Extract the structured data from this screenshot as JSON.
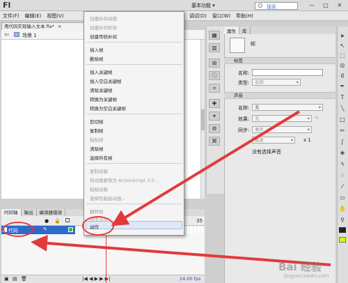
{
  "app": {
    "logo": "Fl",
    "workspace": "基本功能 ▾",
    "search_placeholder": "搜索"
  },
  "window_controls": {
    "minimize": "—",
    "maximize": "□",
    "close": "✕"
  },
  "menubar": {
    "items": [
      "文件(F)",
      "编辑(E)",
      "视图(V)"
    ],
    "right_items": [
      "调试(D)",
      "窗口(W)",
      "帮助(H)"
    ]
  },
  "document": {
    "tab_title": "用代码实现输入文本.fla*",
    "tab_close": "×",
    "scene": "场景 1"
  },
  "context_menu": {
    "items": [
      {
        "label": "创建补间动画",
        "enabled": false
      },
      {
        "label": "创建补间形状",
        "enabled": false
      },
      {
        "label": "创建传统补间",
        "enabled": true
      },
      {
        "label": "插入帧",
        "enabled": true
      },
      {
        "label": "删除帧",
        "enabled": true
      },
      {
        "label": "插入关键帧",
        "enabled": true
      },
      {
        "label": "插入空白关键帧",
        "enabled": true
      },
      {
        "label": "清除关键帧",
        "enabled": true
      },
      {
        "label": "转换为关键帧",
        "enabled": true
      },
      {
        "label": "转换为空白关键帧",
        "enabled": true
      },
      {
        "label": "剪切帧",
        "enabled": true
      },
      {
        "label": "复制帧",
        "enabled": true
      },
      {
        "label": "粘贴帧",
        "enabled": false
      },
      {
        "label": "清除帧",
        "enabled": true
      },
      {
        "label": "选择所有帧",
        "enabled": true
      },
      {
        "label": "复制动画",
        "enabled": false
      },
      {
        "label": "将动画复制为 ActionScript 3.0...",
        "enabled": false
      },
      {
        "label": "粘贴动画",
        "enabled": false
      },
      {
        "label": "选择性粘贴动画...",
        "enabled": false
      },
      {
        "label": "翻转帧",
        "enabled": false
      },
      {
        "label": "同步元件",
        "enabled": false
      },
      {
        "label": "动作",
        "enabled": true
      }
    ]
  },
  "timeline": {
    "tabs": [
      "时间轴",
      "输出",
      "编译器错误"
    ],
    "frame_number": "35",
    "layer_name": "代码",
    "fps": "24.00 fps",
    "time": "0.0 s"
  },
  "properties": {
    "tabs": [
      "属性",
      "库"
    ],
    "object_type": "帧",
    "label_section": "标签",
    "name_label": "名称:",
    "type_label": "类型:",
    "type_value": "名称",
    "sound_section": "声音",
    "sound_name_label": "名称:",
    "sound_name_value": "无",
    "effect_label": "效果:",
    "effect_value": "无",
    "sync_label": "同步:",
    "sync_value": "事件",
    "repeat_value": "重复",
    "repeat_count": "x 1",
    "no_sound": "没有选择声音"
  },
  "watermark": {
    "text": "Bai 经验",
    "url": "jingyan.baidu.com"
  }
}
